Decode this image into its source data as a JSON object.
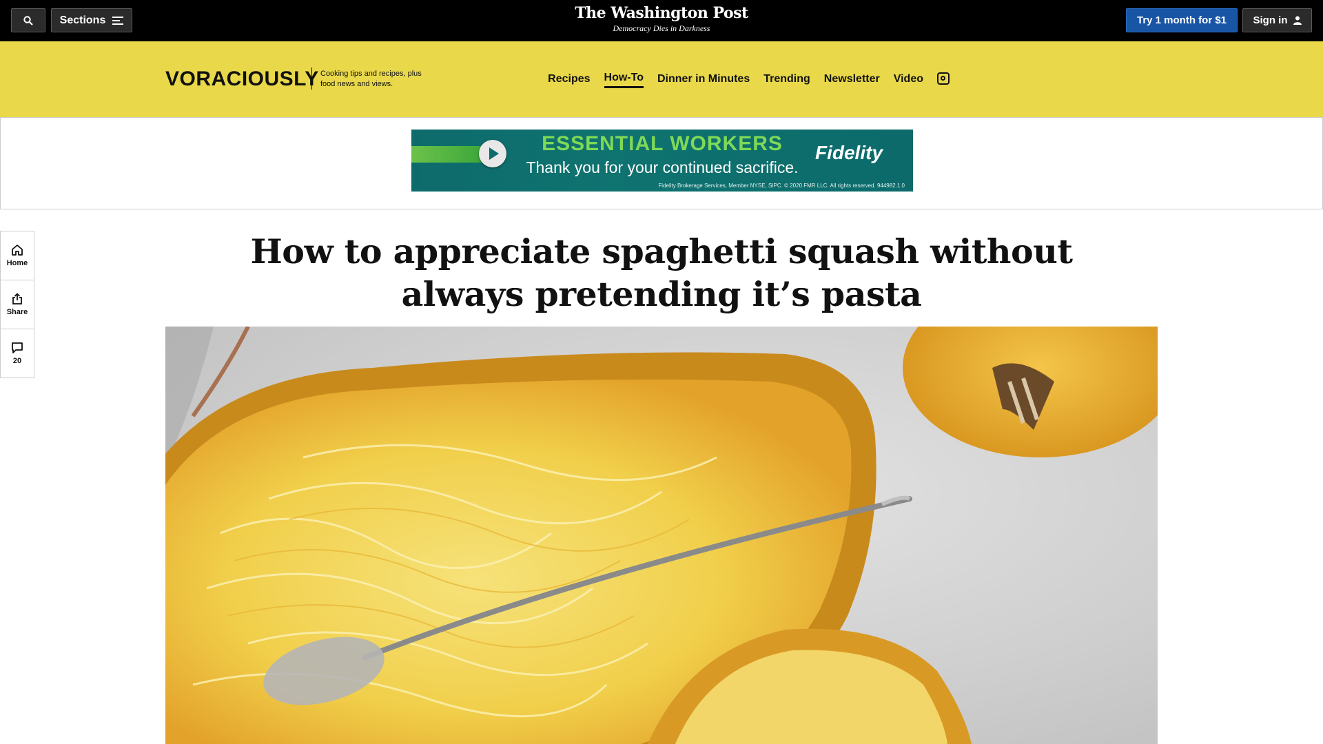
{
  "topbar": {
    "sections_label": "Sections",
    "brand_name": "The Washington Post",
    "brand_tagline": "Democracy Dies in Darkness",
    "subscribe_label": "Try 1 month for $1",
    "signin_label": "Sign in",
    "subscribe_color": "#1955a5"
  },
  "section_header": {
    "logo_text": "VORACIOUSLY",
    "tagline": "Cooking tips and recipes, plus food news and views.",
    "background_color": "#e9d84a",
    "nav": [
      {
        "label": "Recipes"
      },
      {
        "label": "How-To"
      },
      {
        "label": "Dinner in Minutes"
      },
      {
        "label": "Trending"
      },
      {
        "label": "Newsletter"
      },
      {
        "label": "Video"
      }
    ],
    "active_nav": "How-To",
    "social_icon": "instagram-icon"
  },
  "ad": {
    "headline": "ESSENTIAL WORKERS",
    "subline": "Thank you for your continued sacrifice.",
    "brand": "Fidelity",
    "fine_print": "Fidelity Brokerage Services, Member NYSE, SIPC. © 2020 FMR LLC. All rights reserved. 944982.1.0"
  },
  "rail": {
    "home_label": "Home",
    "share_label": "Share",
    "comments_count": "20"
  },
  "article": {
    "headline": "How to appreciate spaghetti squash without always pretending it’s pasta"
  }
}
